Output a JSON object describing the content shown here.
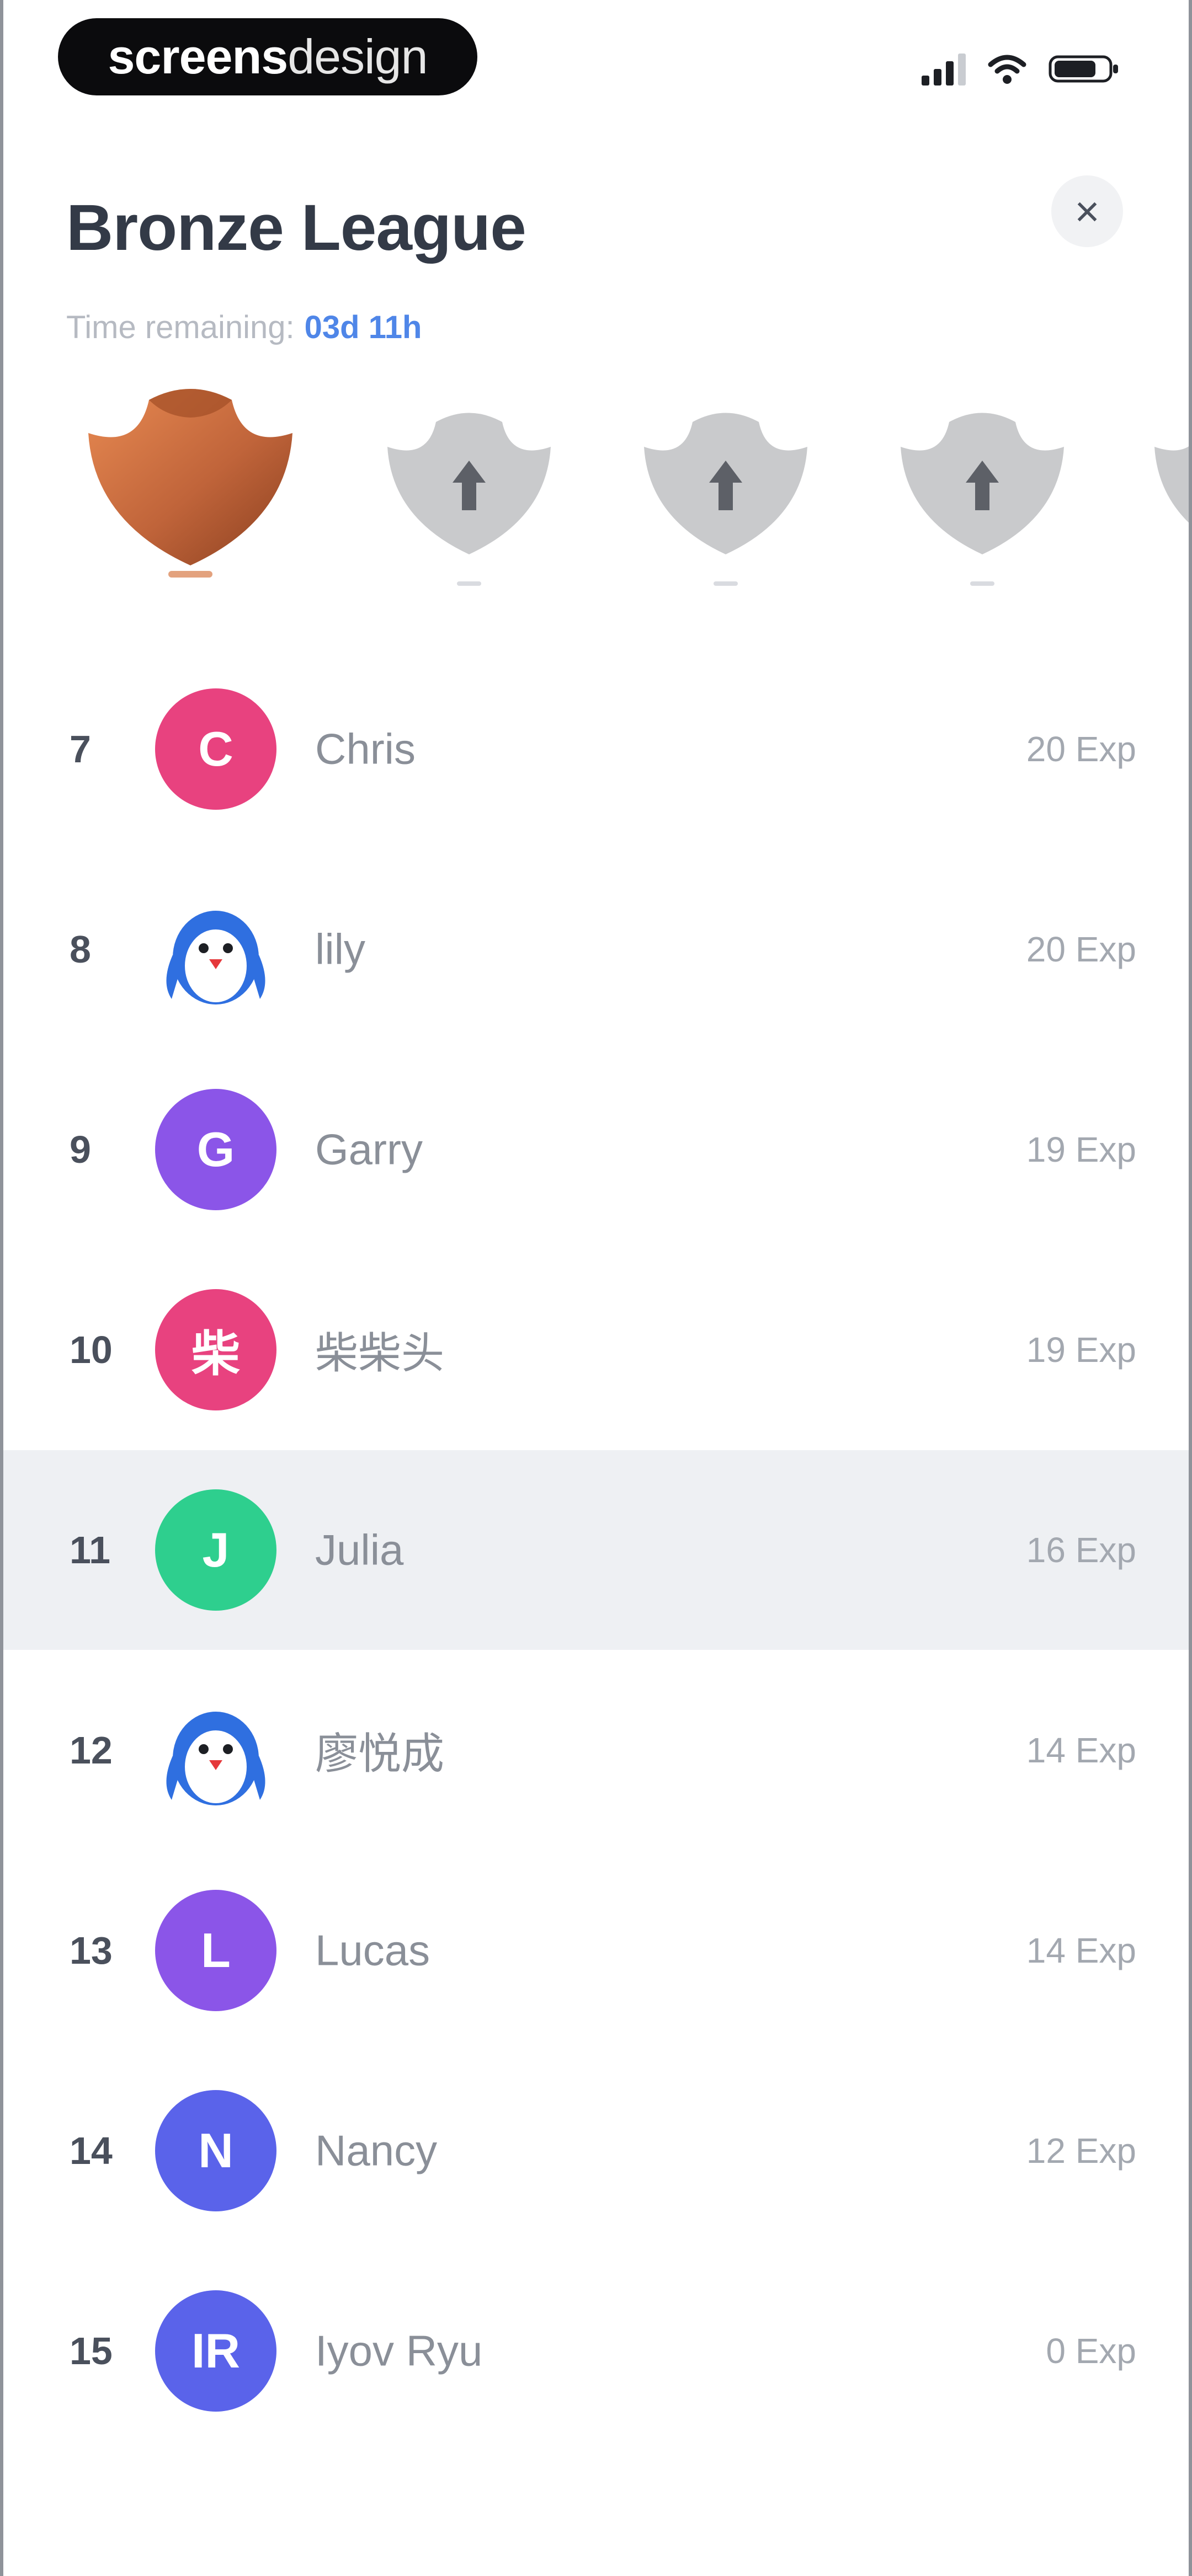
{
  "status_bar": {
    "brand_bold": "screens",
    "brand_light": "design",
    "icons": [
      "signal-icon",
      "wifi-icon",
      "battery-icon"
    ]
  },
  "header": {
    "title": "Bronze League",
    "close_icon": "×",
    "time_label": "Time remaining:",
    "time_value": "03d 11h"
  },
  "leagues": [
    {
      "name": "bronze",
      "state": "current",
      "color": "#c0643a"
    },
    {
      "name": "locked",
      "state": "locked",
      "color": "#c9cacc"
    },
    {
      "name": "locked",
      "state": "locked",
      "color": "#c9cacc"
    },
    {
      "name": "locked",
      "state": "locked",
      "color": "#c9cacc"
    },
    {
      "name": "locked",
      "state": "locked",
      "color": "#c9cacc"
    }
  ],
  "leaderboard": [
    {
      "rank": "7",
      "initials": "C",
      "name": "Chris",
      "score": "20 Exp",
      "avatar_color": "#e8427f",
      "avatar_type": "initials"
    },
    {
      "rank": "8",
      "initials": "",
      "name": "lily",
      "score": "20 Exp",
      "avatar_color": "#2f6fe0",
      "avatar_type": "penguin"
    },
    {
      "rank": "9",
      "initials": "G",
      "name": "Garry",
      "score": "19 Exp",
      "avatar_color": "#8b55e8",
      "avatar_type": "initials"
    },
    {
      "rank": "10",
      "initials": "柴",
      "name": "柴柴头",
      "score": "19 Exp",
      "avatar_color": "#e8427f",
      "avatar_type": "initials"
    },
    {
      "rank": "11",
      "initials": "J",
      "name": "Julia",
      "score": "16 Exp",
      "avatar_color": "#2ecf8e",
      "avatar_type": "initials",
      "highlighted": true
    },
    {
      "rank": "12",
      "initials": "",
      "name": "廖悦成",
      "score": "14 Exp",
      "avatar_color": "#2f6fe0",
      "avatar_type": "penguin"
    },
    {
      "rank": "13",
      "initials": "L",
      "name": "Lucas",
      "score": "14 Exp",
      "avatar_color": "#8b55e8",
      "avatar_type": "initials"
    },
    {
      "rank": "14",
      "initials": "N",
      "name": "Nancy",
      "score": "12 Exp",
      "avatar_color": "#5a63ea",
      "avatar_type": "initials"
    },
    {
      "rank": "15",
      "initials": "IR",
      "name": "Iyov Ryu",
      "score": "0 Exp",
      "avatar_color": "#5a63ea",
      "avatar_type": "initials"
    }
  ]
}
